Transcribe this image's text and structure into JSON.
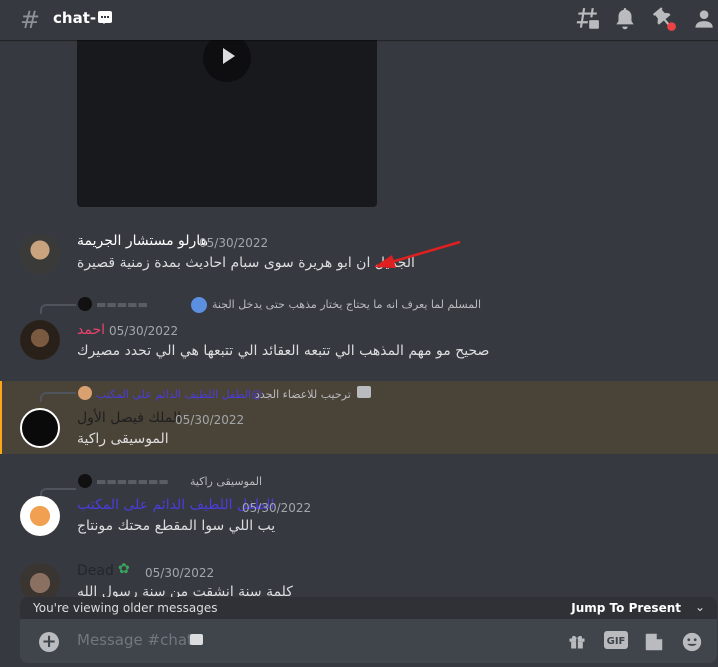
{
  "header": {
    "channel_name": "chat-",
    "icons": [
      "hashtag-icon",
      "threads-icon",
      "bell-icon",
      "pin-icon",
      "members-icon"
    ]
  },
  "messages": [
    {
      "id": "m1",
      "username": "هارلو مستشار الجريمة",
      "username_color": "#ffffff",
      "timestamp": "05/30/2022",
      "text": "الجميل ان ابو هريرة سوى سبام احاديث بمدة زمنية قصيرة"
    },
    {
      "id": "m2",
      "reply_text": "المسلم لما يعرف انه ما يحتاج يختار مذهب حتى يدخل الجنة",
      "username": "احمد",
      "username_color": "#e9436c",
      "timestamp": "05/30/2022",
      "text": "صحيح مو مهم المذهب الي تتبعه العقائد الي تتبعها هي الي تحدد مصيرك"
    },
    {
      "id": "m3",
      "reply_author": "الطفل اللطيف الدائم على المكتب@",
      "reply_text": "ترحيب للاعضاء الجدد",
      "username": "الملك فيصل الأول",
      "username_color": "#1f1f1f",
      "timestamp": "05/30/2022",
      "text": "الموسيقى راكية",
      "highlighted": true
    },
    {
      "id": "m4",
      "reply_text": "الموسيقى راكية",
      "username": "الطفل اللطيف الدائم على المكتب",
      "username_color": "#4a3ddb",
      "timestamp": "05/30/2022",
      "text": "يب اللي سوا المقطع محتك مونتاج"
    },
    {
      "id": "m5",
      "username": "Dead",
      "username_color": "#23272a",
      "timestamp": "05/30/2022",
      "text": "كلمة سنة انشقت من سنة رسول الله"
    }
  ],
  "older_bar": {
    "text": "You're viewing older messages",
    "jump_label": "Jump To Present"
  },
  "composer": {
    "placeholder": "Message #chat-"
  },
  "colors": {
    "background": "#36393f",
    "highlight_bg": "#4a4337",
    "highlight_border": "#faa81a",
    "arrow": "#e02020"
  }
}
